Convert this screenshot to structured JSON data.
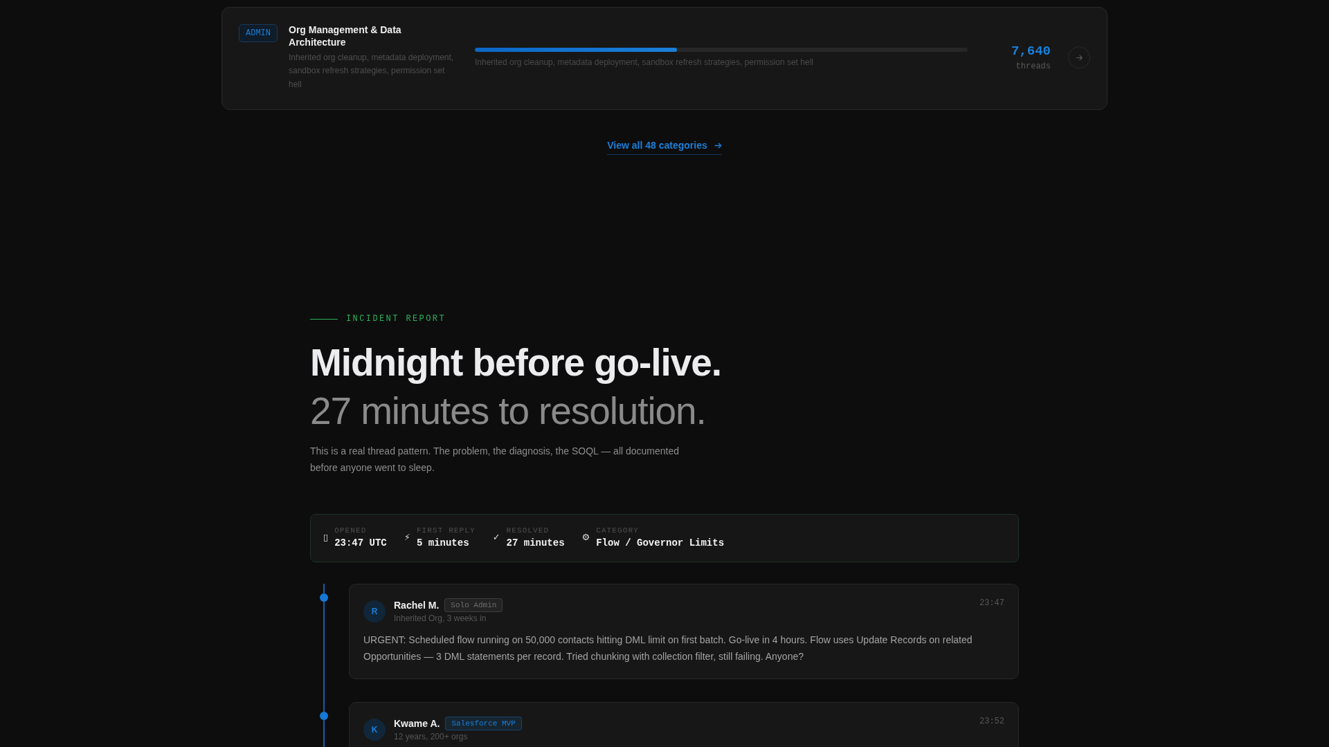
{
  "category_card": {
    "tag": "ADMIN",
    "title": "Org Management & Data Architecture",
    "description": "Inherited org cleanup, metadata deployment, sandbox refresh strategies, permission set hell",
    "level": 0.41,
    "progress_caption": "Inherited org cleanup, metadata deployment, sandbox refresh strategies, permission set hell",
    "count": "7,640",
    "count_label": "threads"
  },
  "view_all_link": {
    "label": "View all 48 categories"
  },
  "incident": {
    "eyebrow": "INCIDENT REPORT",
    "headline": "Midnight before go-live.",
    "subheadline": "27 minutes to resolution.",
    "intro": "This is a real thread pattern. The problem, the diagnosis, the SOQL — all documented before anyone went to sleep.",
    "stats": [
      {
        "icon": "▯",
        "label": "OPENED",
        "value": "23:47 UTC"
      },
      {
        "icon": "⚡",
        "label": "FIRST REPLY",
        "value": "5 minutes"
      },
      {
        "icon": "✓",
        "label": "RESOLVED",
        "value": "27 minutes"
      },
      {
        "icon": "⚙",
        "label": "CATEGORY",
        "value": "Flow / Governor Limits"
      }
    ],
    "thread": [
      {
        "avatar_initial": "R",
        "author": "Rachel M.",
        "role": {
          "label": "Solo Admin",
          "color": "#6e6e6e"
        },
        "subtitle": "Inherited Org, 3 weeks in",
        "time": "23:47",
        "message": "URGENT: Scheduled flow running on 50,000 contacts hitting DML limit on first batch. Go-live in 4 hours. Flow uses Update Records on related Opportunities — 3 DML statements per record. Tried chunking with collection filter, still failing. Anyone?"
      },
      {
        "avatar_initial": "K",
        "author": "Kwame A.",
        "role": {
          "label": "Salesforce MVP",
          "color": "#1a7fd8"
        },
        "subtitle": "12 years, 200+ orgs",
        "time": "23:52"
      }
    ]
  }
}
